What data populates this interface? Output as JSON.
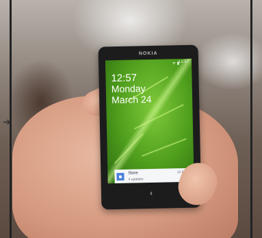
{
  "phone": {
    "brand": "NOKIA",
    "status_time": "12:57",
    "status_icons": "ᯤ ▮",
    "lock_screen": {
      "time": "12:57",
      "day": "Monday",
      "date": "March 24"
    },
    "notification": {
      "app": "Store",
      "subtitle": "4 updates",
      "time": "12:56",
      "icon": "bag-icon"
    },
    "nav": {
      "back_glyph": "‹"
    }
  },
  "side_arrow": "➔"
}
